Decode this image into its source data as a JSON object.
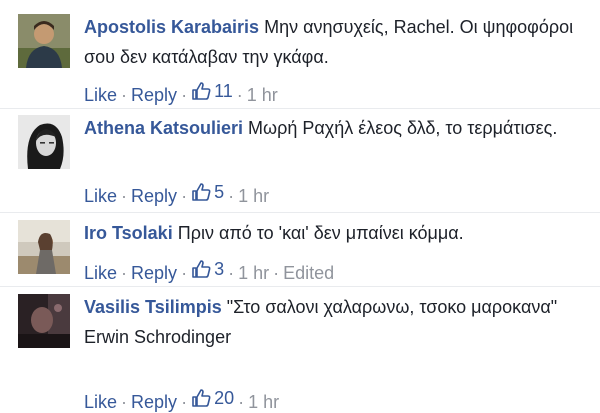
{
  "comments": [
    {
      "author": "Apostolis Karabairis",
      "text": "Μην ανησυχείς, Rachel. Οι ψηφοφόροι σου δεν κατάλαβαν την γκάφα.",
      "extra": "",
      "like_label": "Like",
      "reply_label": "Reply",
      "likes": "11",
      "time": "1 hr",
      "edited": ""
    },
    {
      "author": "Athena Katsoulieri",
      "text": "Μωρή Ραχήλ έλεος δλδ, το τερμάτισες.",
      "extra": "",
      "like_label": "Like",
      "reply_label": "Reply",
      "likes": "5",
      "time": "1 hr",
      "edited": ""
    },
    {
      "author": "Iro Tsolaki",
      "text": "Πριν από το 'και' δεν μπαίνει κόμμα.",
      "extra": "",
      "like_label": "Like",
      "reply_label": "Reply",
      "likes": "3",
      "time": "1 hr",
      "edited": "Edited"
    },
    {
      "author": "Vasilis Tsilimpis",
      "text": "\"Στο σαλονι χαλαρωνω, τσοκο μαροκανα\"",
      "extra": "Erwin Schrodinger",
      "like_label": "Like",
      "reply_label": "Reply",
      "likes": "20",
      "time": "1 hr",
      "edited": ""
    }
  ],
  "colors": {
    "author": "#365899",
    "text": "#1d2129",
    "meta": "#90949c",
    "separator": "#e9ebee"
  },
  "icons": {
    "like": "thumbs-up-icon"
  }
}
